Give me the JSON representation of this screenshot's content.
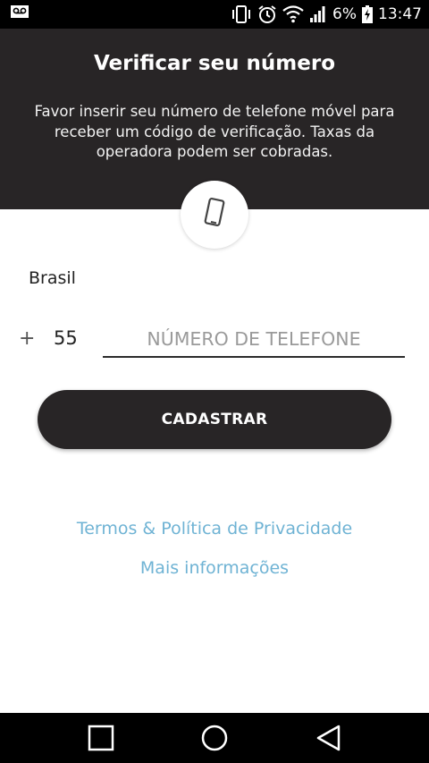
{
  "status_bar": {
    "left_icon": "voicemail-icon",
    "icons": [
      "vibrate-icon",
      "alarm-icon",
      "wifi-icon",
      "signal-icon"
    ],
    "battery_percent": "6%",
    "battery_icon": "battery-charging-icon",
    "time": "13:47"
  },
  "header": {
    "title": "Verificar seu número",
    "description": "Favor inserir seu número de telefone móvel para receber um código de verificação. Taxas da operadora podem ser cobradas."
  },
  "badge_icon": "mobile-phone-icon",
  "form": {
    "country": "Brasil",
    "plus_sign": "+",
    "country_code": "55",
    "phone_value": "",
    "phone_placeholder": "NÚMERO DE TELEFONE",
    "submit_label": "CADASTRAR"
  },
  "links": {
    "terms": "Termos & Política de Privacidade",
    "more_info": "Mais informações"
  },
  "nav": {
    "recents_icon": "square-recents-icon",
    "home_icon": "circle-home-icon",
    "back_icon": "triangle-back-icon"
  },
  "colors": {
    "header_bg": "#282526",
    "button_bg": "#282526",
    "link": "#6fb3d4"
  }
}
